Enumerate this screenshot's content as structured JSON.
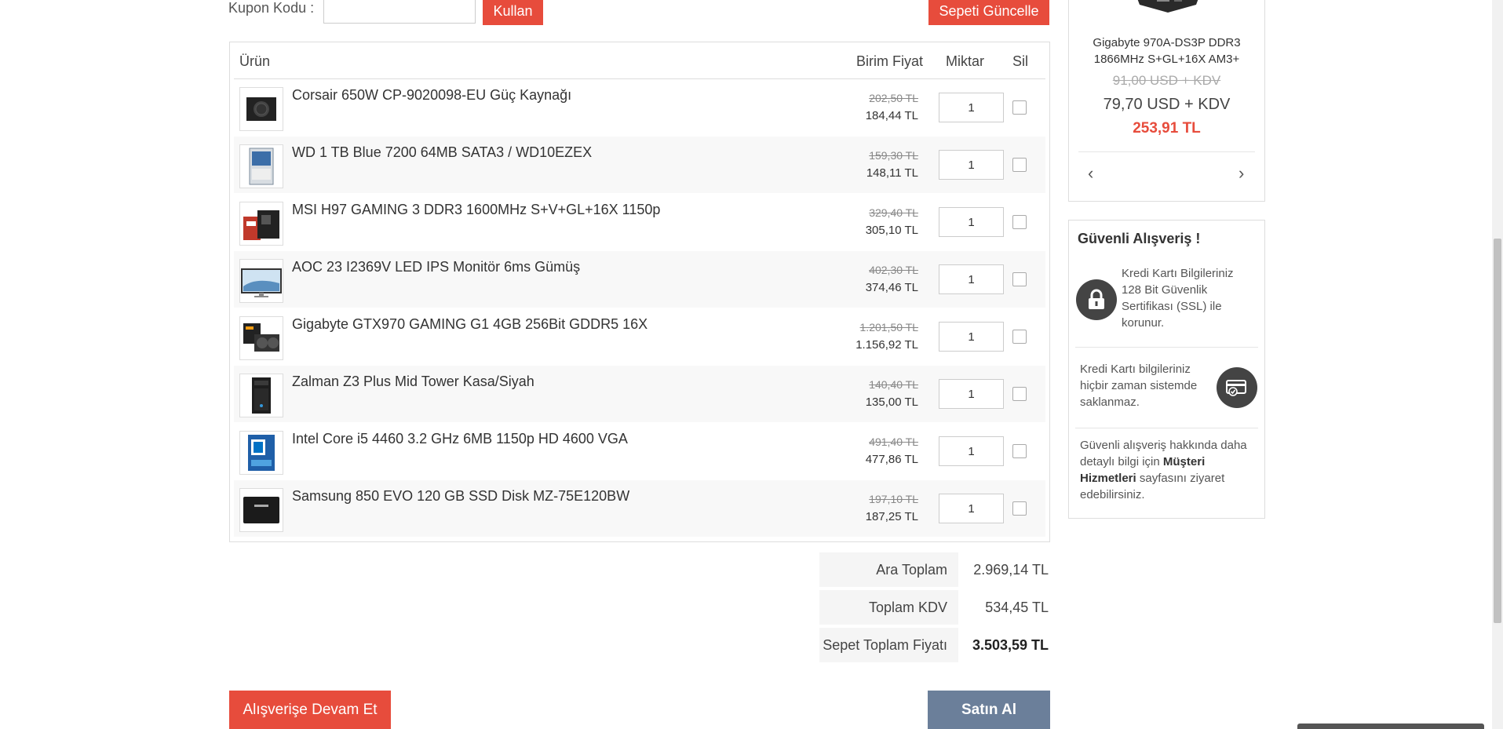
{
  "coupon": {
    "label": "Kupon Kodu :",
    "apply_label": "Kullan",
    "update_label": "Sepeti Güncelle"
  },
  "table": {
    "headers": {
      "product": "Ürün",
      "unit_price": "Birim Fiyat",
      "quantity": "Miktar",
      "delete": "Sil"
    },
    "items": [
      {
        "name": "Corsair 650W CP-9020098-EU Güç Kaynağı",
        "old_price": "202,50 TL",
        "price": "184,44 TL",
        "qty": "1"
      },
      {
        "name": "WD 1 TB Blue 7200 64MB SATA3 / WD10EZEX",
        "old_price": "159,30 TL",
        "price": "148,11 TL",
        "qty": "1"
      },
      {
        "name": "MSI H97 GAMING 3 DDR3 1600MHz S+V+GL+16X 1150p",
        "old_price": "329,40 TL",
        "price": "305,10 TL",
        "qty": "1"
      },
      {
        "name": "AOC 23 I2369V LED IPS Monitör 6ms Gümüş",
        "old_price": "402,30 TL",
        "price": "374,46 TL",
        "qty": "1"
      },
      {
        "name": "Gigabyte GTX970 GAMING G1 4GB 256Bit GDDR5 16X",
        "old_price": "1.201,50 TL",
        "price": "1.156,92 TL",
        "qty": "1"
      },
      {
        "name": "Zalman Z3 Plus Mid Tower Kasa/Siyah",
        "old_price": "140,40 TL",
        "price": "135,00 TL",
        "qty": "1"
      },
      {
        "name": "Intel Core i5 4460 3.2 GHz 6MB 1150p HD 4600 VGA",
        "old_price": "491,40 TL",
        "price": "477,86 TL",
        "qty": "1"
      },
      {
        "name": "Samsung 850 EVO 120 GB SSD Disk MZ-75E120BW",
        "old_price": "197,10 TL",
        "price": "187,25 TL",
        "qty": "1"
      }
    ]
  },
  "totals": {
    "subtotal_label": "Ara Toplam",
    "subtotal": "2.969,14 TL",
    "vat_label": "Toplam KDV",
    "vat": "534,45 TL",
    "grand_label": "Sepet Toplam Fiyatı",
    "grand": "3.503,59 TL"
  },
  "actions": {
    "continue_label": "Alışverişe Devam Et",
    "buy_label": "Satın Al"
  },
  "featured": {
    "name_line1": "Gigabyte 970A-DS3P DDR3",
    "name_line2": "1866MHz S+GL+16X AM3+",
    "old_price": "91,00 USD + KDV",
    "price_usd": "79,70 USD + KDV",
    "price_tl": "253,91 TL",
    "prev_icon": "‹",
    "next_icon": "›"
  },
  "secure": {
    "title": "Güvenli Alışveriş !",
    "item1": "Kredi Kartı Bilgileriniz 128 Bit Güvenlik Sertifikası (SSL) ile korunur.",
    "item2": "Kredi Kartı bilgileriniz hiçbir zaman sistemde saklanmaz.",
    "item3_pre": "Güvenli alışveriş hakkında daha detaylı bilgi için ",
    "item3_link": "Müşteri Hizmetleri",
    "item3_post": " sayfasını ziyaret edebilirsiniz."
  },
  "colors": {
    "accent": "#e74c3c",
    "buy": "#6b7f9a"
  }
}
